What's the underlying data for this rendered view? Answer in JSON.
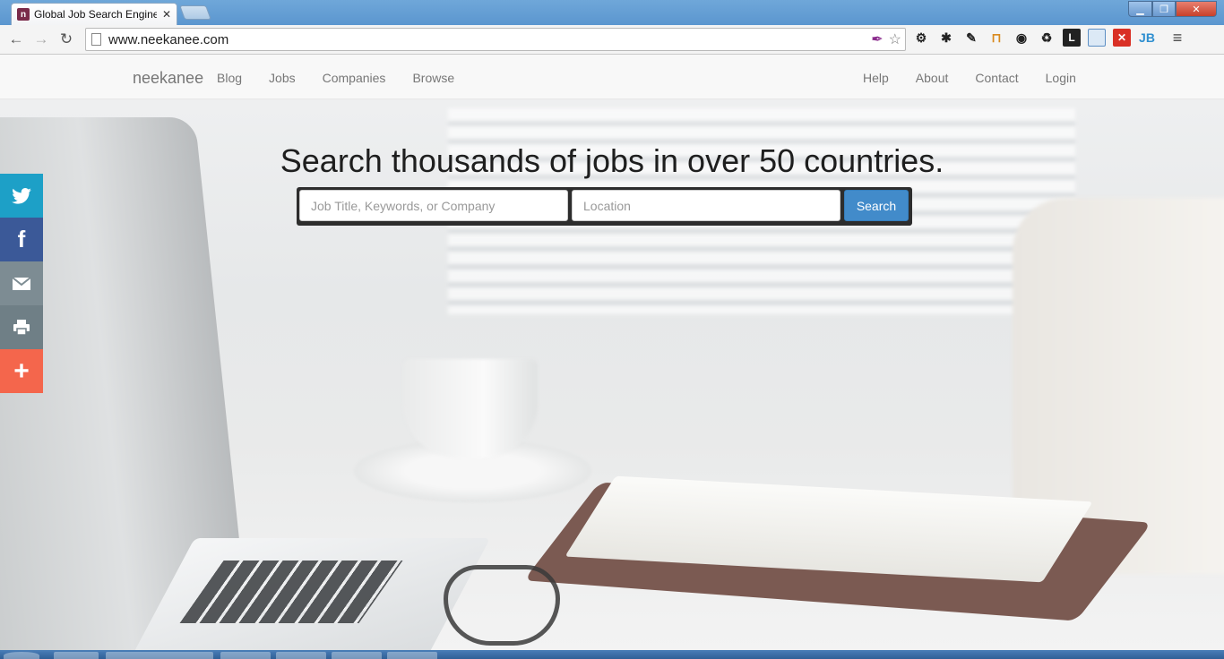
{
  "browser": {
    "tab_title": "Global Job Search Engine |",
    "tab_favicon_letter": "n",
    "tab_close": "✕",
    "url": "www.neekanee.com",
    "window_controls": {
      "minimize": "▁",
      "maximize": "❐",
      "close": "✕"
    },
    "nav": {
      "back": "←",
      "forward": "→",
      "reload": "↻"
    },
    "extensions": [
      {
        "name": "gear-icon",
        "glyph": "⚙"
      },
      {
        "name": "bug-icon",
        "glyph": "✱"
      },
      {
        "name": "eyedropper-icon",
        "glyph": "✎"
      },
      {
        "name": "tag-icon",
        "glyph": "⊓"
      },
      {
        "name": "chrome-settings-icon",
        "glyph": "◉"
      },
      {
        "name": "recycle-icon",
        "glyph": "♻"
      },
      {
        "name": "l-extension-icon",
        "glyph": "L"
      },
      {
        "name": "window-extension-icon",
        "glyph": ""
      },
      {
        "name": "x-extension-icon",
        "glyph": "✕"
      },
      {
        "name": "jb-extension-icon",
        "glyph": "JB"
      }
    ],
    "menu_glyph": "≡"
  },
  "navbar": {
    "brand": "neekanee",
    "left_links": [
      "Blog",
      "Jobs",
      "Companies",
      "Browse"
    ],
    "right_links": [
      "Help",
      "About",
      "Contact",
      "Login"
    ]
  },
  "hero": {
    "headline": "Search thousands of jobs in over 50 countries.",
    "keyword_placeholder": "Job Title, Keywords, or Company",
    "location_placeholder": "Location",
    "search_button": "Search"
  },
  "share": {
    "twitter": "🐦",
    "facebook": "f",
    "email": "✉",
    "print": "⎙",
    "more": "+"
  },
  "colors": {
    "search_button": "#428bca",
    "twitter": "#1da0c7",
    "facebook": "#3b5998",
    "more": "#f4664c"
  }
}
